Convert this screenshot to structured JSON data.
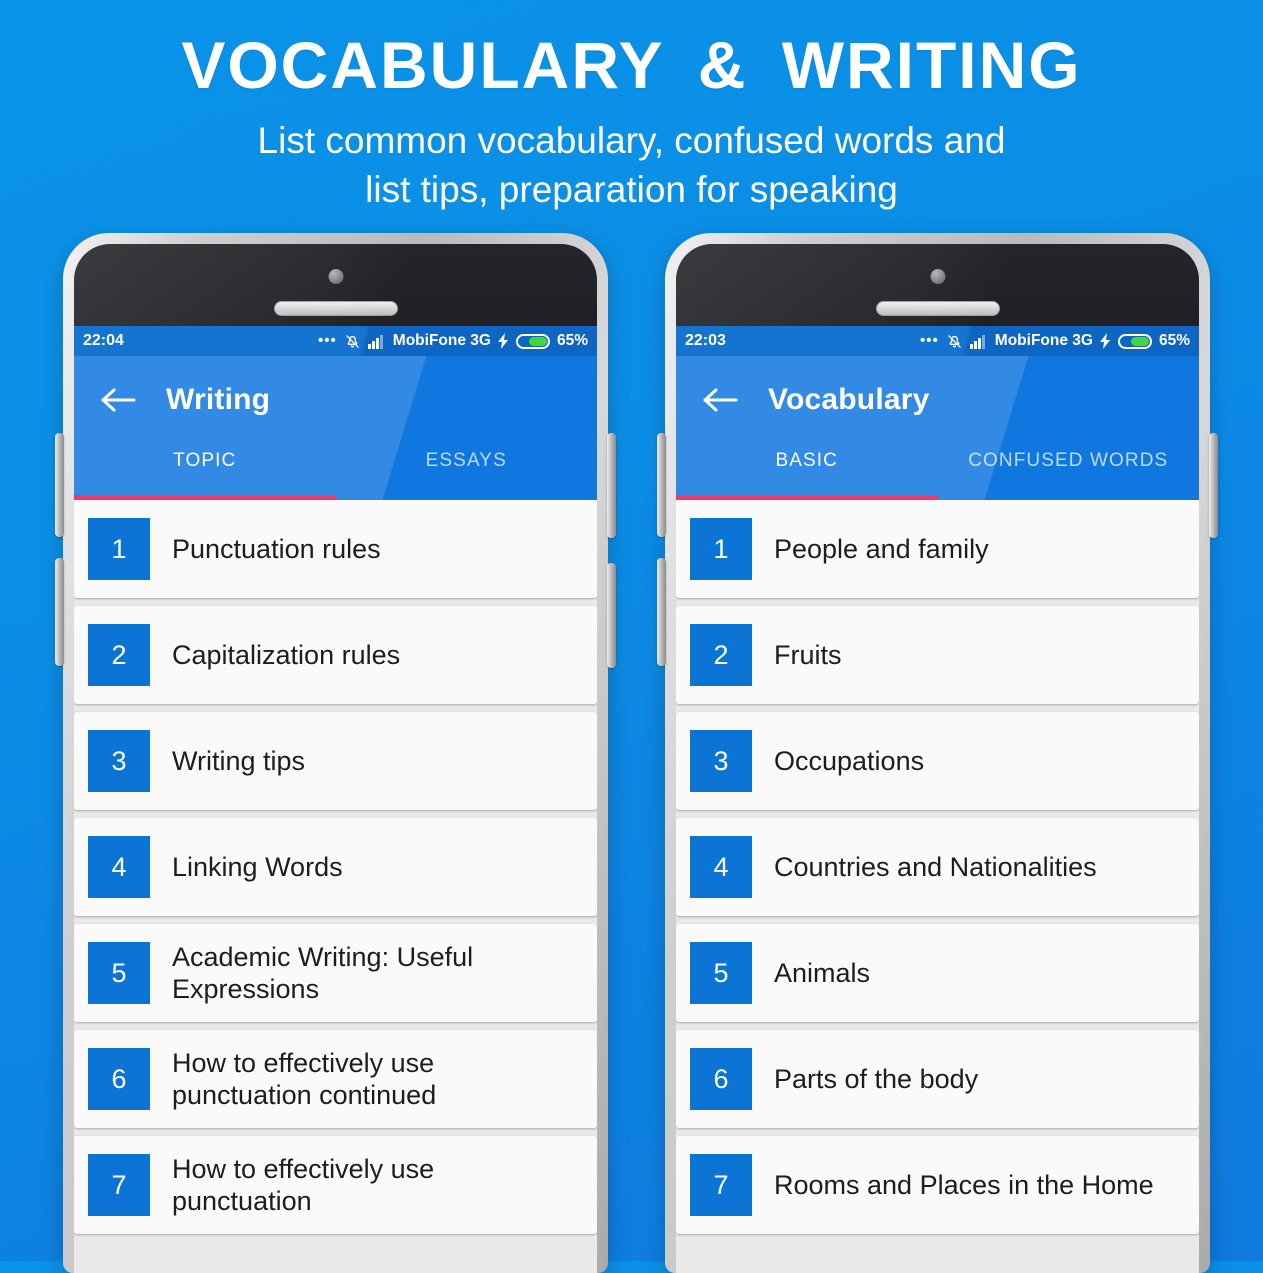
{
  "hero": {
    "title": "VOCABULARY  &  WRITING",
    "subtitle_line1": "List common vocabulary, confused words and",
    "subtitle_line2": "list tips, preparation for speaking"
  },
  "colors": {
    "background_blue": "#0a8ee6",
    "app_bar_blue": "#1177e0",
    "status_bar_blue": "#1474cf",
    "tab_indicator_pink": "#ec3b6b",
    "number_badge_blue": "#0b74d4",
    "battery_green": "#46d63c",
    "card_background": "#fafafa"
  },
  "phones": [
    {
      "id": "writing",
      "status_bar": {
        "time": "22:04",
        "dots_icon": "overflow-dots-icon",
        "mute_icon": "bell-muted-icon",
        "signal_icon": "signal-bars-icon",
        "carrier": "MobiFone 3G",
        "charging_icon": "lightning-bolt-icon",
        "battery_icon": "battery-icon",
        "battery_percent": "65%"
      },
      "app_bar": {
        "back_icon": "back-arrow-icon",
        "title": "Writing",
        "tabs": [
          {
            "label": "TOPIC",
            "active": true
          },
          {
            "label": "ESSAYS",
            "active": false
          }
        ]
      },
      "list": [
        {
          "number": "1",
          "label": "Punctuation rules"
        },
        {
          "number": "2",
          "label": "Capitalization rules"
        },
        {
          "number": "3",
          "label": "Writing tips"
        },
        {
          "number": "4",
          "label": "Linking Words"
        },
        {
          "number": "5",
          "label": "Academic Writing: Useful Expressions"
        },
        {
          "number": "6",
          "label": "How to effectively use punctuation continued"
        },
        {
          "number": "7",
          "label": "How to effectively use punctuation"
        }
      ]
    },
    {
      "id": "vocabulary",
      "status_bar": {
        "time": "22:03",
        "dots_icon": "overflow-dots-icon",
        "mute_icon": "bell-muted-icon",
        "signal_icon": "signal-bars-icon",
        "carrier": "MobiFone 3G",
        "charging_icon": "lightning-bolt-icon",
        "battery_icon": "battery-icon",
        "battery_percent": "65%"
      },
      "app_bar": {
        "back_icon": "back-arrow-icon",
        "title": "Vocabulary",
        "tabs": [
          {
            "label": "BASIC",
            "active": true
          },
          {
            "label": "CONFUSED WORDS",
            "active": false
          }
        ]
      },
      "list": [
        {
          "number": "1",
          "label": "People and family"
        },
        {
          "number": "2",
          "label": "Fruits"
        },
        {
          "number": "3",
          "label": "Occupations"
        },
        {
          "number": "4",
          "label": "Countries and Nationalities"
        },
        {
          "number": "5",
          "label": "Animals"
        },
        {
          "number": "6",
          "label": "Parts of the body"
        },
        {
          "number": "7",
          "label": "Rooms and Places in the Home"
        }
      ]
    }
  ]
}
